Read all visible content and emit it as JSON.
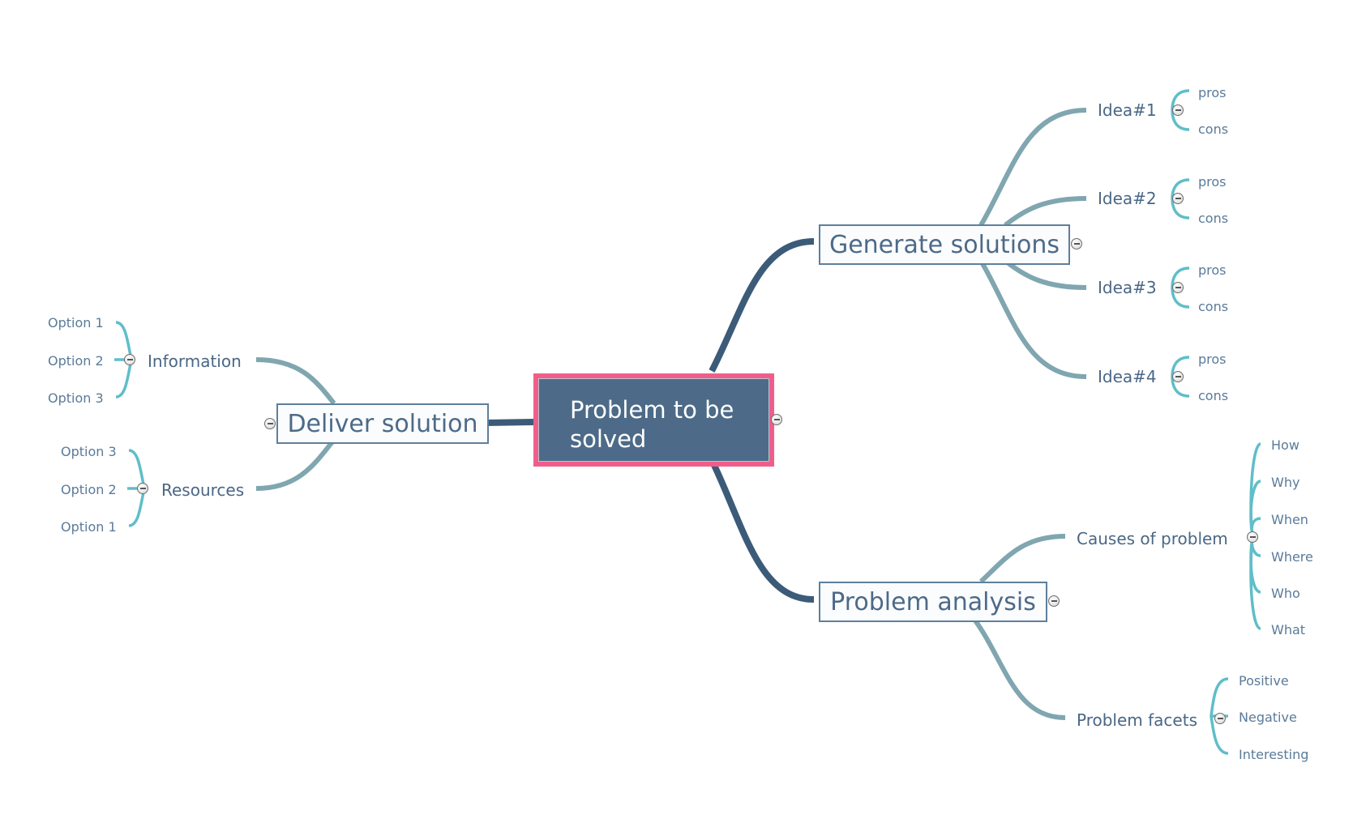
{
  "colors": {
    "main_branch": "#3c5b78",
    "sub_branch": "#80a6b0",
    "leaf_branch": "#5fbec9",
    "root_border": "#ef5e8a",
    "root_fill": "#4d6b88"
  },
  "root": {
    "label": "Problem to be solved",
    "line1": "Problem to be",
    "line2": "solved",
    "collapse_icon": "collapse-icon"
  },
  "branches": {
    "generate": {
      "label": "Generate solutions",
      "ideas": [
        {
          "label": "Idea#1",
          "children": [
            "pros",
            "cons"
          ]
        },
        {
          "label": "Idea#2",
          "children": [
            "pros",
            "cons"
          ]
        },
        {
          "label": "Idea#3",
          "children": [
            "pros",
            "cons"
          ]
        },
        {
          "label": "Idea#4",
          "children": [
            "pros",
            "cons"
          ]
        }
      ]
    },
    "analysis": {
      "label": "Problem analysis",
      "causes": {
        "label": "Causes of problem",
        "children": [
          "How",
          "Why",
          "When",
          "Where",
          "Who",
          "What"
        ]
      },
      "facets": {
        "label": "Problem facets",
        "children": [
          "Positive",
          "Negative",
          "Interesting"
        ]
      }
    },
    "deliver": {
      "label": "Deliver solution",
      "information": {
        "label": "Information",
        "children": [
          "Option 1",
          "Option 2",
          "Option 3"
        ]
      },
      "resources": {
        "label": "Resources",
        "children": [
          "Option 3",
          "Option 2",
          "Option 1"
        ]
      }
    }
  }
}
